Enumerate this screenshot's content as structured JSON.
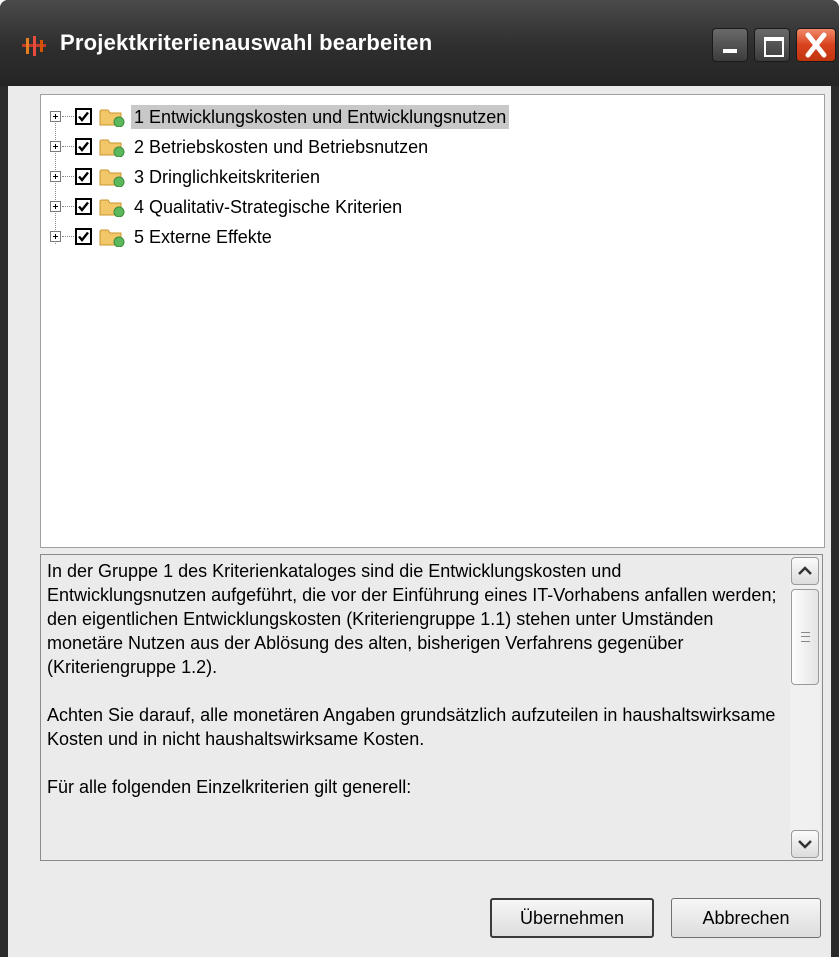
{
  "window": {
    "title": "Projektkriterienauswahl bearbeiten"
  },
  "tree": {
    "items": [
      {
        "label": "1 Entwicklungskosten und Entwicklungsnutzen",
        "checked": true,
        "selected": true
      },
      {
        "label": "2 Betriebskosten und Betriebsnutzen",
        "checked": true,
        "selected": false
      },
      {
        "label": "3 Dringlichkeitskriterien",
        "checked": true,
        "selected": false
      },
      {
        "label": "4 Qualitativ-Strategische Kriterien",
        "checked": true,
        "selected": false
      },
      {
        "label": "5 Externe Effekte",
        "checked": true,
        "selected": false
      }
    ]
  },
  "description": {
    "paragraphs": [
      "In der Gruppe 1 des Kriterienkataloges sind die Entwicklungskosten und Entwicklungsnutzen aufgeführt, die vor der Einführung eines IT-Vorhabens anfallen werden; den eigentlichen Entwicklungskosten (Kriteriengruppe 1.1) stehen unter Umständen monetäre Nutzen aus der Ablösung des alten, bisherigen Verfahrens gegenüber (Kriteriengruppe 1.2).",
      "Achten Sie darauf, alle monetären Angaben grundsätzlich aufzuteilen in haushaltswirksame Kosten und in nicht haushaltswirksame Kosten.",
      "Für alle folgenden Einzelkriterien gilt generell:"
    ]
  },
  "buttons": {
    "ok": "Übernehmen",
    "cancel": "Abbrechen"
  },
  "colors": {
    "titlebar": "#2e2e2e",
    "close_button": "#d9431e",
    "selection": "#c8c8c8",
    "folder": "#f2c76a"
  }
}
